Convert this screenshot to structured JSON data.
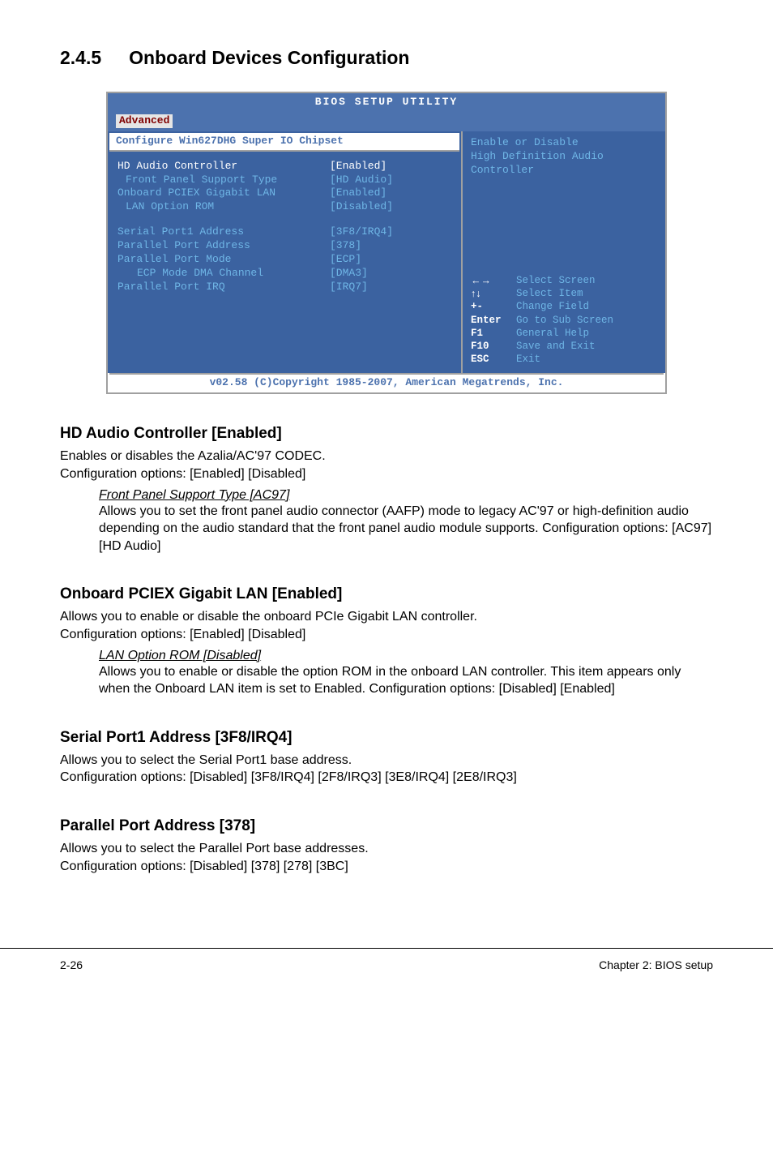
{
  "section": {
    "number": "2.4.5",
    "title": "Onboard Devices Configuration"
  },
  "bios": {
    "title": "BIOS SETUP UTILITY",
    "tab": "Advanced",
    "chipset_header": "Configure Win627DHG Super IO Chipset",
    "rows_group1": [
      {
        "label": "HD Audio Controller",
        "value": "[Enabled]",
        "highlight": true
      },
      {
        "label": "Front Panel Support Type",
        "value": "[HD Audio]",
        "indent": 1
      },
      {
        "label": "Onboard PCIEX Gigabit LAN",
        "value": "[Enabled]"
      },
      {
        "label": "LAN Option ROM",
        "value": "[Disabled]",
        "indent": 1
      }
    ],
    "rows_group2": [
      {
        "label": "Serial Port1 Address",
        "value": "[3F8/IRQ4]"
      },
      {
        "label": "Parallel Port Address",
        "value": "[378]"
      },
      {
        "label": "Parallel Port Mode",
        "value": "[ECP]"
      },
      {
        "label": "ECP Mode DMA Channel",
        "value": "[DMA3]",
        "indent": 2
      },
      {
        "label": "Parallel Port IRQ",
        "value": "[IRQ7]"
      }
    ],
    "help_top": "Enable or Disable\nHigh Definition Audio\nController",
    "help_nav": [
      {
        "key": "←→",
        "desc": "Select Screen"
      },
      {
        "key": "↑↓",
        "desc": "Select Item"
      },
      {
        "key": "+-",
        "desc": "Change Field"
      },
      {
        "key": "Enter",
        "desc": "Go to Sub Screen"
      },
      {
        "key": "F1",
        "desc": "General Help"
      },
      {
        "key": "F10",
        "desc": "Save and Exit"
      },
      {
        "key": "ESC",
        "desc": "Exit"
      }
    ],
    "footer": "v02.58 (C)Copyright 1985-2007, American Megatrends, Inc."
  },
  "hd_audio": {
    "heading": "HD Audio Controller [Enabled]",
    "line1": "Enables or disables the Azalia/AC'97 CODEC.",
    "line2": "Configuration options: [Enabled] [Disabled]",
    "sub_heading": "Front Panel Support Type [AC97]",
    "sub_body": "Allows you to set the front panel audio connector (AAFP) mode to legacy AC'97 or high-definition audio depending on the audio standard that the front panel audio module supports. Configuration options: [AC97][HD Audio]"
  },
  "pciex": {
    "heading": "Onboard PCIEX Gigabit LAN [Enabled]",
    "line1": "Allows you to enable or disable the onboard PCIe Gigabit LAN controller.",
    "line2": "Configuration options: [Enabled] [Disabled]",
    "sub_heading": "LAN Option ROM [Disabled]",
    "sub_body": "Allows you to enable or disable the option ROM in the onboard LAN controller. This item appears only when the Onboard LAN item is set to Enabled. Configuration options: [Disabled] [Enabled]"
  },
  "serial": {
    "heading": "Serial Port1 Address [3F8/IRQ4]",
    "line1": "Allows you to select the Serial Port1 base address.",
    "line2": "Configuration options: [Disabled] [3F8/IRQ4] [2F8/IRQ3] [3E8/IRQ4] [2E8/IRQ3]"
  },
  "parallel": {
    "heading": "Parallel Port Address [378]",
    "line1": "Allows you to select the Parallel Port base addresses.",
    "line2": "Configuration options: [Disabled] [378] [278] [3BC]"
  },
  "footer": {
    "left": "2-26",
    "right": "Chapter 2: BIOS setup"
  }
}
